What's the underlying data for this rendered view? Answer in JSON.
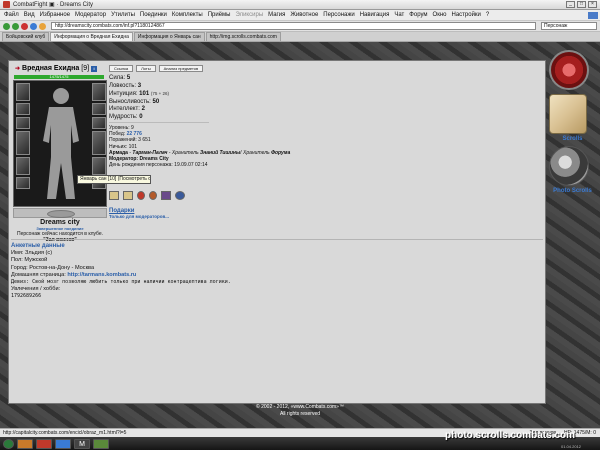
{
  "window": {
    "title": "CombatFight ▣ · Dreams City"
  },
  "menu": [
    "Файл",
    "Вид",
    "Избранное",
    "Модератор",
    "Утилиты",
    "Поединки",
    "Комплекты",
    "Приёмы",
    "Эликсиры",
    "Магия",
    "Животное",
    "Персонажи",
    "Навигация",
    "Чат",
    "Форум",
    "Окно",
    "Настройки",
    "?"
  ],
  "nav": {
    "address": "http://dreamscity.combats.com/inf.pl?1180124867",
    "search": "Персонаж"
  },
  "tabs": [
    "Бойцовский клуб",
    "Информация о Вредная Ехидна",
    "Информация о Январь сан",
    "http://img.scrolls.combats.com"
  ],
  "character": {
    "name": "Вредная Ехидна",
    "level": "[9]",
    "hp": "1475/1475",
    "hp_fraction": 1.0,
    "buttons": [
      "Ссылка",
      "Лоты",
      "Анализ предметов"
    ],
    "stats": [
      {
        "label": "Сила:",
        "value": "5",
        "extra": ""
      },
      {
        "label": "Ловкость:",
        "value": "3",
        "extra": ""
      },
      {
        "label": "Интуиция:",
        "value": "101",
        "extra": "(75 + 26)"
      },
      {
        "label": "Выносливость:",
        "value": "50",
        "extra": ""
      },
      {
        "label": "Интеллект:",
        "value": "2",
        "extra": ""
      },
      {
        "label": "Мудрость:",
        "value": "0",
        "extra": ""
      }
    ],
    "info": {
      "level": "Уровень: 9",
      "wins_label": "Побед:",
      "wins": "22 776",
      "losses": "Поражений: 3 651",
      "draws": "Ничьих: 101",
      "align_a": "Армада",
      "align_b": "Тарман-Палач",
      "keeper1": "Хранитель",
      "keeper1_b": "Знаний Тишины",
      "keeper2": "Хранитель",
      "keeper2_b": "Форума",
      "moderator": "Модератор: Dreams City",
      "born": "День рождения персонажа: 19.09.07 02:14"
    },
    "location": {
      "city": "Dreams city",
      "status": "Завершенное поединие",
      "where": "Персонаж сейчас находится в клубе.",
      "room": "\"Зал воинов\""
    },
    "tooltip": "Январь сан [10] (Посмотреть образ)",
    "gifts": {
      "title": "Подарки",
      "sub": "Только для модераторов..."
    }
  },
  "personal": {
    "header": "Анкетные данные",
    "name": "Имя: Зльдия (с)",
    "sex": "Пол: Мужской",
    "city": "Город: Ростов-на-Дону - Москва",
    "homepage_label": "Домашняя страница:",
    "homepage": "http://tarmans.kombats.ru",
    "motto": "Девиз: Свой мозг позволяю любить только при наличии контрацептива логики.",
    "hobby": "Увлечения / хобби:",
    "icq": "1792689266"
  },
  "sidebar": {
    "scrolls": "Scrolls",
    "photo": "Photo Scrolls"
  },
  "footer": {
    "line1": "© 2002 - 2012, «www.Combats.com»™",
    "line2": "All rights reserved"
  },
  "status": {
    "url": "http://capitalcity.combats.com/encicl/obraz_m1.html?l=5",
    "room": "Зал воинов",
    "hp": "HP: 1475/M: 0"
  },
  "watermark": "photo.scrolls.combats.com",
  "clock": "01.04.2012"
}
